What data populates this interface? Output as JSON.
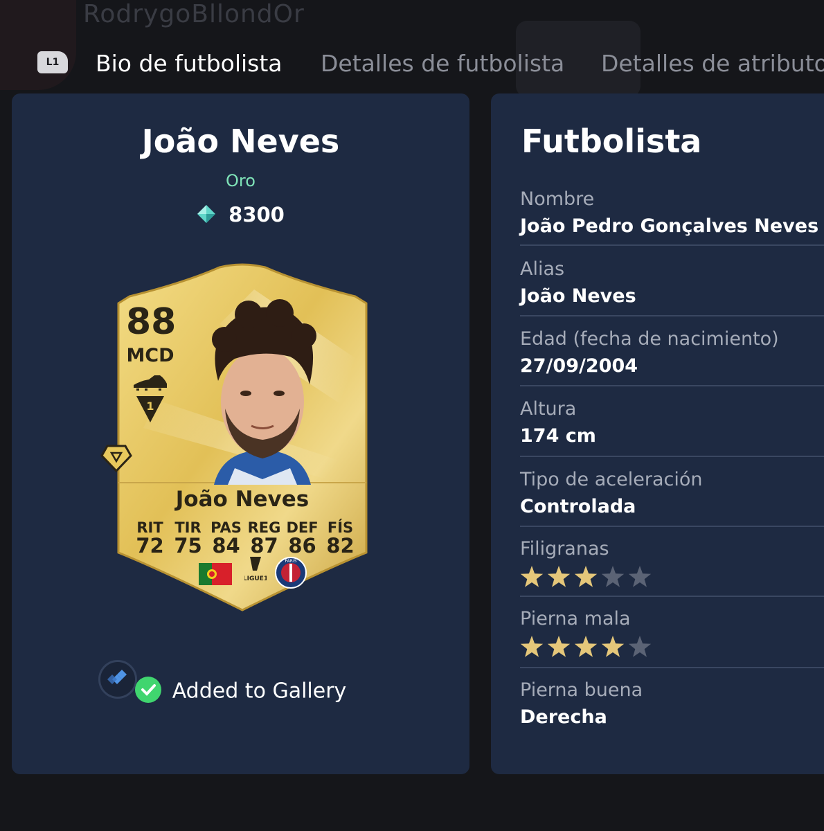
{
  "background": {
    "username": "RodrygoBllondOr"
  },
  "tabs": {
    "shoulder_button": "L1",
    "items": [
      {
        "label": "Bio de futbolista",
        "active": true
      },
      {
        "label": "Detalles de futbolista",
        "active": false
      },
      {
        "label": "Detalles de atributos",
        "active": false
      }
    ]
  },
  "player": {
    "name": "João Neves",
    "rarity": "Oro",
    "price": "8300",
    "gallery_status": "Added to Gallery"
  },
  "card": {
    "rating": "88",
    "position": "MCD",
    "name": "João Neves",
    "league_label": "LIGUE1",
    "club_label": "PARIS",
    "stats": [
      {
        "label": "RIT",
        "value": "72"
      },
      {
        "label": "TIR",
        "value": "75"
      },
      {
        "label": "PAS",
        "value": "84"
      },
      {
        "label": "REG",
        "value": "87"
      },
      {
        "label": "DEF",
        "value": "86"
      },
      {
        "label": "FÍS",
        "value": "82"
      }
    ]
  },
  "info": {
    "title": "Futbolista",
    "rows": [
      {
        "label": "Nombre",
        "value": "João Pedro Gonçalves Neves"
      },
      {
        "label": "Alias",
        "value": "João Neves"
      },
      {
        "label": "Edad (fecha de nacimiento)",
        "value": "27/09/2004"
      },
      {
        "label": "Altura",
        "value": "174 cm"
      },
      {
        "label": "Tipo de aceleración",
        "value": "Controlada"
      },
      {
        "label": "Filigranas",
        "stars": 3,
        "max": 5
      },
      {
        "label": "Pierna mala",
        "stars": 4,
        "max": 5
      },
      {
        "label": "Pierna buena",
        "value": "Derecha"
      }
    ]
  },
  "colors": {
    "panel": "#1e2a42",
    "rarity_green": "#7fe3b8",
    "star_gold": "#e5c77a",
    "star_empty": "#5b6375",
    "check_green": "#40d56f",
    "card_gold": "#e8c95d"
  }
}
